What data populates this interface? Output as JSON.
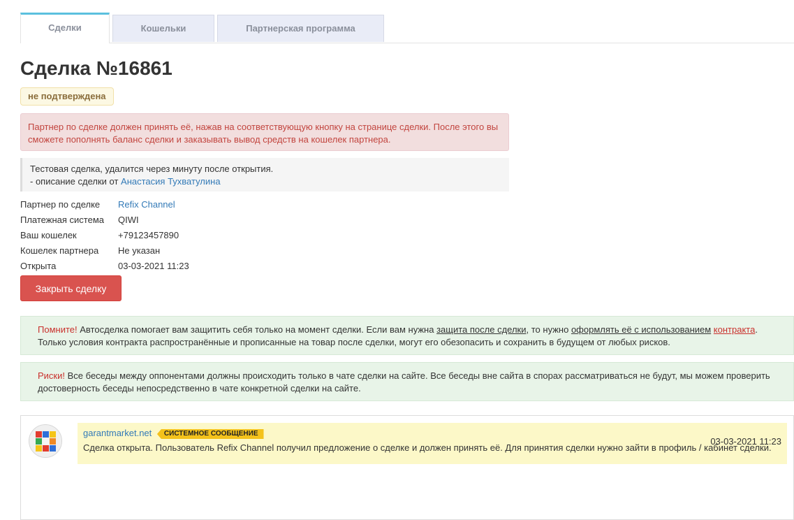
{
  "tabs": [
    {
      "label": "Сделки",
      "active": true
    },
    {
      "label": "Кошельки",
      "active": false
    },
    {
      "label": "Партнерская программа",
      "active": false
    }
  ],
  "deal": {
    "title": "Сделка №16861",
    "status": "не подтверждена"
  },
  "warning": "Партнер по сделке должен принять её, нажав на соответствующую кнопку на странице сделки. После этого вы сможете пополнять баланс сделки и заказывать вывод средств на кошелек партнера.",
  "description": {
    "text": "Тестовая сделка, удалится через минуту после открытия.",
    "author_prefix": "- описание сделки от",
    "author": "Анастасия Тухватулина"
  },
  "info": [
    {
      "label": "Партнер по сделке",
      "value": "Refix Channel",
      "link": true
    },
    {
      "label": "Платежная система",
      "value": "QIWI",
      "link": false
    },
    {
      "label": "Ваш кошелек",
      "value": "+79123457890",
      "link": false
    },
    {
      "label": "Кошелек партнера",
      "value": "Не указан",
      "link": false
    },
    {
      "label": "Открыта",
      "value": "03-03-2021 11:23",
      "link": false
    }
  ],
  "close_button": "Закрыть сделку",
  "notice1": {
    "lead": "Помните!",
    "text1": "Автосделка помогает вам защитить себя только на момент сделки. Если вам нужна",
    "link1": "защита после сделки",
    "text2": ", то нужно",
    "link2": "оформлять её с использованием",
    "link3": "контракта",
    "text3": ".",
    "text4": "Только условия контракта распространённые и прописанные на товар после сделки, могут его обезопасить и сохранить в будущем от любых рисков."
  },
  "notice2": {
    "lead": "Риски!",
    "text": "Все беседы между оппонентами должны происходить только в чате сделки на сайте. Все беседы вне сайта в спорах рассматриваться не будут, мы можем проверить достоверность беседы непосредственно в чате конкретной сделки на сайте."
  },
  "chat": {
    "author": "garantmarket.net",
    "badge": "СИСТЕМНОЕ СООБЩЕНИЕ",
    "time": "03-03-2021 11:23",
    "text": "Сделка открыта. Пользователь Refix Channel получил предложение о сделке и должен принять её. Для принятия сделки нужно зайти в профиль / кабинет сделки."
  },
  "colors": {
    "danger": "#d9534f",
    "link": "#337ab7",
    "tab_accent": "#5bc0de",
    "badge_system": "#f4c21b"
  }
}
